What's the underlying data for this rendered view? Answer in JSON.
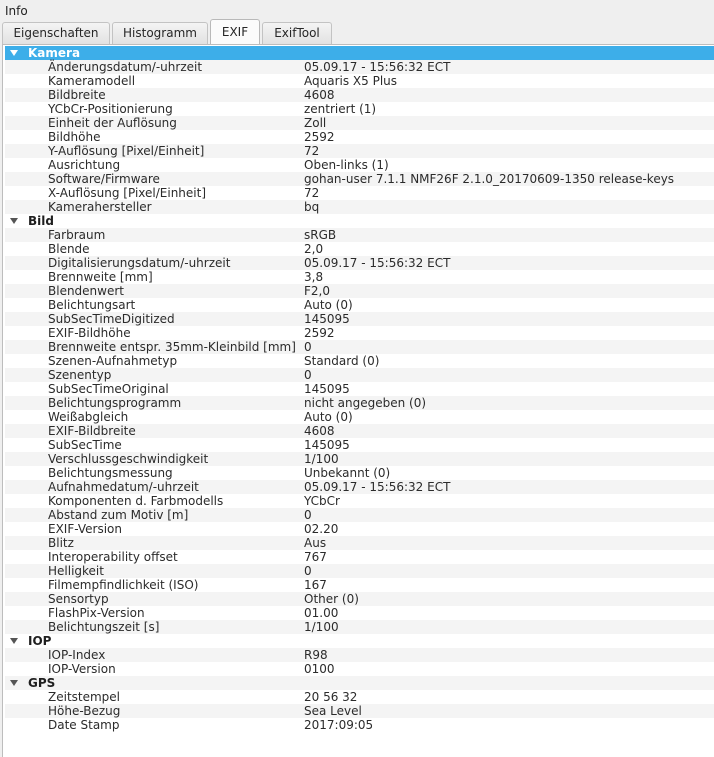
{
  "window": {
    "title": "Info"
  },
  "tabs": [
    {
      "label": "Eigenschaften",
      "active": false
    },
    {
      "label": "Histogramm",
      "active": false
    },
    {
      "label": "EXIF",
      "active": true
    },
    {
      "label": "ExifTool",
      "active": false
    }
  ],
  "groups": [
    {
      "name": "Kamera",
      "selected": true,
      "items": [
        {
          "label": "Änderungsdatum/-uhrzeit",
          "value": "05.09.17 - 15:56:32 ECT"
        },
        {
          "label": "Kameramodell",
          "value": "Aquaris X5 Plus"
        },
        {
          "label": "Bildbreite",
          "value": "4608"
        },
        {
          "label": "YCbCr-Positionierung",
          "value": "zentriert (1)"
        },
        {
          "label": "Einheit der Auflösung",
          "value": "Zoll"
        },
        {
          "label": "Bildhöhe",
          "value": "2592"
        },
        {
          "label": "Y-Auflösung [Pixel/Einheit]",
          "value": "72"
        },
        {
          "label": "Ausrichtung",
          "value": "Oben-links (1)"
        },
        {
          "label": "Software/Firmware",
          "value": "gohan-user 7.1.1 NMF26F 2.1.0_20170609-1350 release-keys"
        },
        {
          "label": "X-Auflösung [Pixel/Einheit]",
          "value": "72"
        },
        {
          "label": "Kamerahersteller",
          "value": "bq"
        }
      ]
    },
    {
      "name": "Bild",
      "selected": false,
      "items": [
        {
          "label": "Farbraum",
          "value": "sRGB"
        },
        {
          "label": "Blende",
          "value": "2,0"
        },
        {
          "label": "Digitalisierungsdatum/-uhrzeit",
          "value": "05.09.17 - 15:56:32 ECT"
        },
        {
          "label": "Brennweite [mm]",
          "value": "3,8"
        },
        {
          "label": "Blendenwert",
          "value": "F2,0"
        },
        {
          "label": "Belichtungsart",
          "value": "Auto (0)"
        },
        {
          "label": "SubSecTimeDigitized",
          "value": "145095"
        },
        {
          "label": "EXIF-Bildhöhe",
          "value": "2592"
        },
        {
          "label": "Brennweite entspr. 35mm-Kleinbild [mm]",
          "value": "0"
        },
        {
          "label": "Szenen-Aufnahmetyp",
          "value": "Standard (0)"
        },
        {
          "label": "Szenentyp",
          "value": "0"
        },
        {
          "label": "SubSecTimeOriginal",
          "value": "145095"
        },
        {
          "label": "Belichtungsprogramm",
          "value": "nicht angegeben (0)"
        },
        {
          "label": "Weißabgleich",
          "value": "Auto (0)"
        },
        {
          "label": "EXIF-Bildbreite",
          "value": "4608"
        },
        {
          "label": "SubSecTime",
          "value": "145095"
        },
        {
          "label": "Verschlussgeschwindigkeit",
          "value": "1/100"
        },
        {
          "label": "Belichtungsmessung",
          "value": "Unbekannt (0)"
        },
        {
          "label": "Aufnahmedatum/-uhrzeit",
          "value": "05.09.17 - 15:56:32 ECT"
        },
        {
          "label": "Komponenten d. Farbmodells",
          "value": "YCbCr"
        },
        {
          "label": "Abstand zum Motiv [m]",
          "value": "0"
        },
        {
          "label": "EXIF-Version",
          "value": "02.20"
        },
        {
          "label": "Blitz",
          "value": "Aus"
        },
        {
          "label": "Interoperability offset",
          "value": "767"
        },
        {
          "label": "Helligkeit",
          "value": "0"
        },
        {
          "label": "Filmempfindlichkeit (ISO)",
          "value": "167"
        },
        {
          "label": "Sensortyp",
          "value": "Other (0)"
        },
        {
          "label": "FlashPix-Version",
          "value": "01.00"
        },
        {
          "label": "Belichtungszeit [s]",
          "value": "1/100"
        }
      ]
    },
    {
      "name": "IOP",
      "selected": false,
      "items": [
        {
          "label": "IOP-Index",
          "value": "R98"
        },
        {
          "label": "IOP-Version",
          "value": "0100"
        }
      ]
    },
    {
      "name": "GPS",
      "selected": false,
      "items": [
        {
          "label": "Zeitstempel",
          "value": "20 56 32"
        },
        {
          "label": "Höhe-Bezug",
          "value": "Sea Level"
        },
        {
          "label": "Date Stamp",
          "value": "2017:09:05"
        }
      ]
    }
  ],
  "colors": {
    "selection": "#3daee9",
    "alternate_row": "#f4f4f4"
  },
  "icons": {
    "expand_icon": "triangle-down"
  }
}
